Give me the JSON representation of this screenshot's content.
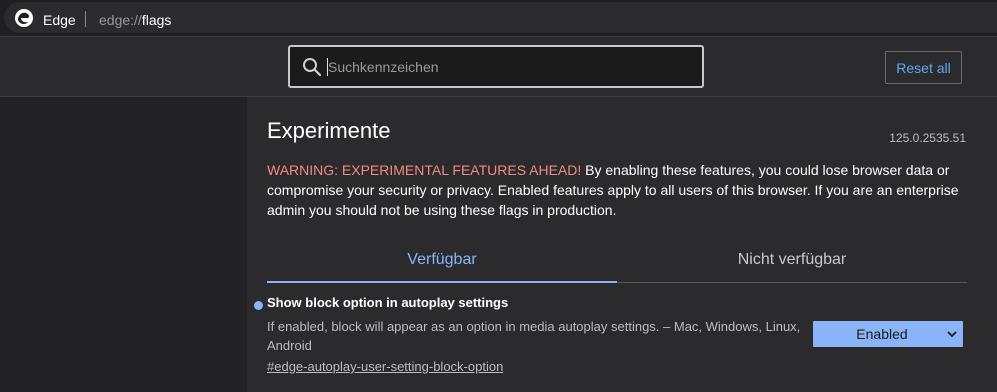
{
  "browser": {
    "brand": "Edge",
    "url_scheme": "edge://",
    "url_host": "flags"
  },
  "header": {
    "search_placeholder": "Suchkennzeichen",
    "reset_label": "Reset all"
  },
  "main": {
    "title": "Experimente",
    "version": "125.0.2535.51",
    "warning_highlight": "WARNING: EXPERIMENTAL FEATURES AHEAD!",
    "warning_text": " By enabling these features, you could lose browser data or compromise your security or privacy. Enabled features apply to all users of this browser. If you are an enterprise admin you should not be using these flags in production.",
    "tabs": [
      {
        "label": "Verfügbar",
        "active": true
      },
      {
        "label": "Nicht verfügbar",
        "active": false
      }
    ]
  },
  "flags": [
    {
      "title": "Show block option in autoplay settings",
      "description": "If enabled, block will appear as an option in media autoplay settings. – Mac, Windows, Linux, Android",
      "link": "#edge-autoplay-user-setting-block-option",
      "selected": "Enabled"
    }
  ],
  "colors": {
    "accent": "#8ab4f8",
    "warning": "#f28b82",
    "reset_text": "#5ea8f0"
  }
}
